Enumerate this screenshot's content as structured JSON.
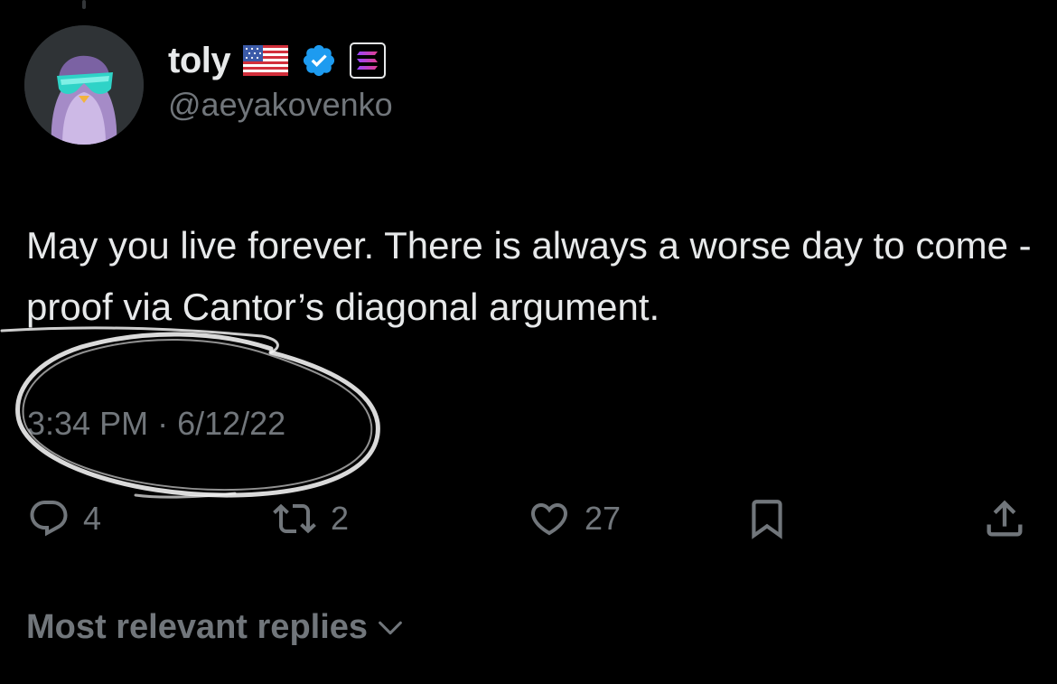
{
  "author": {
    "display_name": "toly",
    "handle": "@aeyakovenko",
    "badges": [
      "us-flag-icon",
      "verified-check-icon",
      "solana-logo-icon"
    ],
    "verified_color": "#1d9bf0"
  },
  "tweet": {
    "text": "May you live forever. There is always a worse day to come - proof via Cantor’s diagonal argument.",
    "time": "3:34 PM",
    "separator": "·",
    "date": "6/12/22"
  },
  "actions": {
    "reply": {
      "icon": "reply-icon",
      "count": "4"
    },
    "retweet": {
      "icon": "retweet-icon",
      "count": "2"
    },
    "like": {
      "icon": "heart-icon",
      "count": "27"
    },
    "bookmark": {
      "icon": "bookmark-icon"
    },
    "share": {
      "icon": "share-icon"
    }
  },
  "replies": {
    "sort_label": "Most relevant replies",
    "icon": "chevron-down-icon"
  },
  "colors": {
    "background": "#000000",
    "primary_text": "#e7e9ea",
    "secondary_text": "#71767b",
    "accent": "#1d9bf0",
    "annotation": "#f2f2f2"
  }
}
